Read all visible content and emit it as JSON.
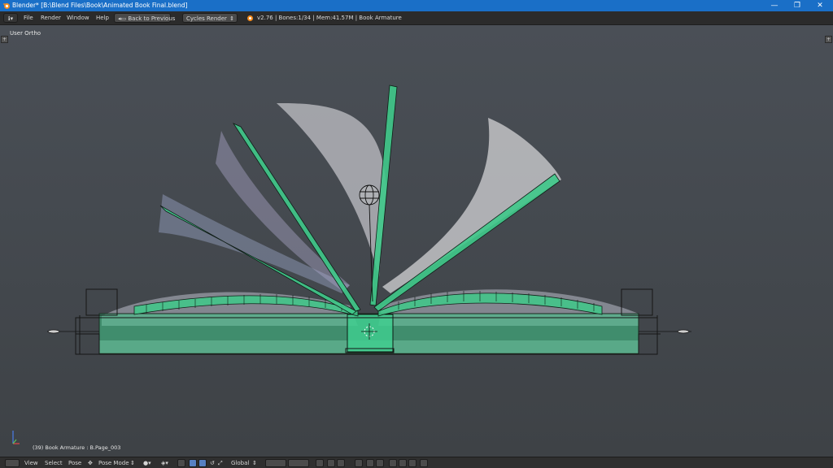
{
  "window": {
    "title": "Blender* [B:\\Blend Files\\Book\\Animated Book Final.blend]",
    "minimize": "—",
    "maximize": "❐",
    "close": "✕"
  },
  "info_header": {
    "menu": [
      "File",
      "Render",
      "Window",
      "Help"
    ],
    "back_button": "Back to Previous",
    "render_engine": "Cycles Render",
    "stats": "v2.76 | Bones:1/34  | Mem:41.57M | Book Armature"
  },
  "viewport": {
    "view_label": "User Ortho",
    "object_info": "(39) Book Armature : B.Page_003"
  },
  "footer": {
    "view": "View",
    "select": "Select",
    "pose": "Pose",
    "mode": "Pose Mode",
    "orientation": "Global"
  },
  "colors": {
    "accent": "#1a6fc7",
    "bone_green": "#3fc98a",
    "viewport_bg": "#454a50"
  },
  "icons": [
    "blender-logo-icon",
    "info-editor-icon",
    "back-icon",
    "render-engine-icon",
    "mode-icon",
    "shading-icon",
    "manipulator-icon",
    "snap-icon",
    "proportional-icon",
    "axis-gizmo-icon"
  ]
}
